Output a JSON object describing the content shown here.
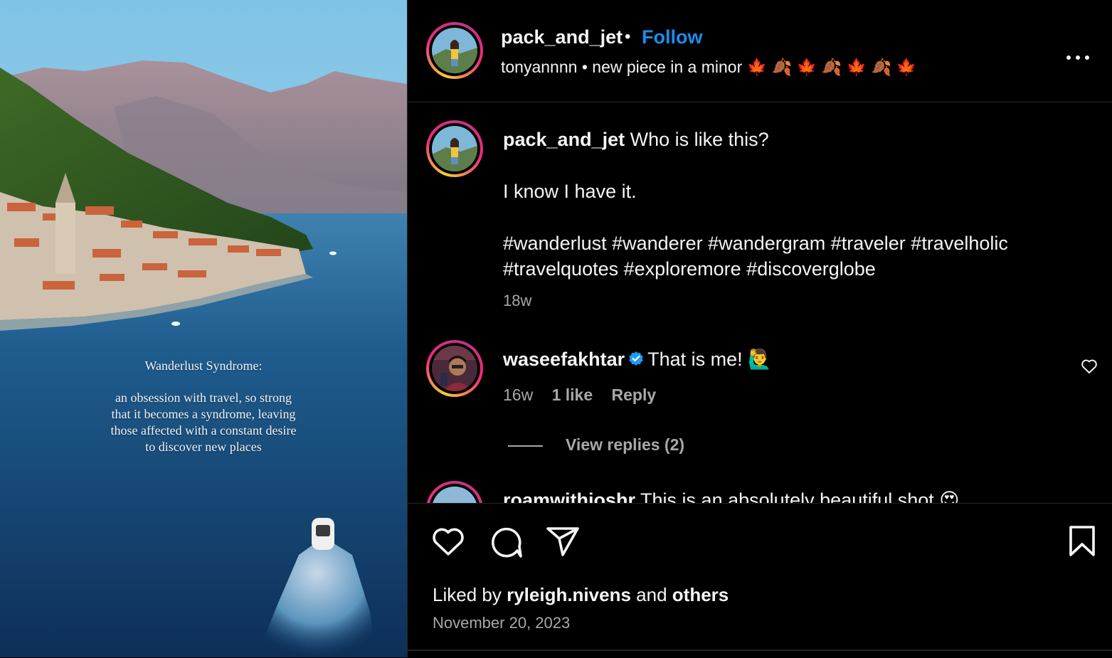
{
  "media": {
    "overlay_title": "Wanderlust Syndrome:",
    "overlay_lines": [
      "an obsession with travel, so strong",
      "that it becomes a syndrome, leaving",
      "those affected with a constant desire",
      "to discover new places"
    ]
  },
  "header": {
    "username": "pack_and_jet",
    "separator": "•",
    "follow_label": "Follow",
    "audio_artist": "tonyannnn",
    "audio_title": "new piece in a minor",
    "audio_emojis": "🍁 🍂 🍁 🍂 🍁 🍂 🍁",
    "more_icon": "more-horizontal-icon"
  },
  "caption": {
    "username": "pack_and_jet",
    "line1": "Who is like this?",
    "line2": "I know I have it.",
    "hashtags_line1": "#wanderlust #wanderer #wandergram #traveler #travelholic",
    "hashtags_line2": "#travelquotes #exploremore #discoverglobe",
    "time": "18w"
  },
  "comments": [
    {
      "username": "waseefakhtar",
      "verified": true,
      "text": "That is me! 🙋‍♂️",
      "time": "16w",
      "likes": "1 like",
      "reply_label": "Reply",
      "view_replies": "View replies (2)"
    },
    {
      "username": "roamwithjoshr",
      "text": "This is an absolutely beautiful shot 😍"
    }
  ],
  "actions": {
    "liked_prefix": "Liked by",
    "liked_user": "ryleigh.nivens",
    "liked_and": "and",
    "liked_others": "others",
    "date": "November 20, 2023"
  },
  "colors": {
    "background": "#000000",
    "follow_blue": "#1a8cf0",
    "muted_text": "#a8a8a8",
    "verified_blue": "#1d9bf0"
  }
}
